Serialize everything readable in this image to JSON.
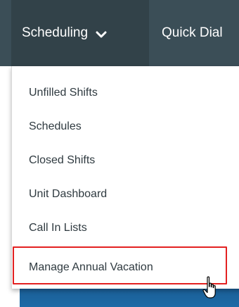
{
  "navbar": {
    "active_menu_label": "Scheduling",
    "next_menu_label": "Quick Dial"
  },
  "dropdown": {
    "items": [
      {
        "label": "Unfilled Shifts"
      },
      {
        "label": "Schedules"
      },
      {
        "label": "Closed Shifts"
      },
      {
        "label": "Unit Dashboard"
      },
      {
        "label": "Call In Lists"
      },
      {
        "label": "Manage Annual Vacation"
      }
    ],
    "highlighted_item_index": 5
  },
  "icons": {
    "chevron": "chevron-down-icon",
    "cursor": "hand-pointer-icon"
  },
  "colors": {
    "navbar_bg": "#3b4e57",
    "active_tab_bg": "#324249",
    "highlight_border": "#e32121",
    "menu_text": "#2f3a40"
  }
}
